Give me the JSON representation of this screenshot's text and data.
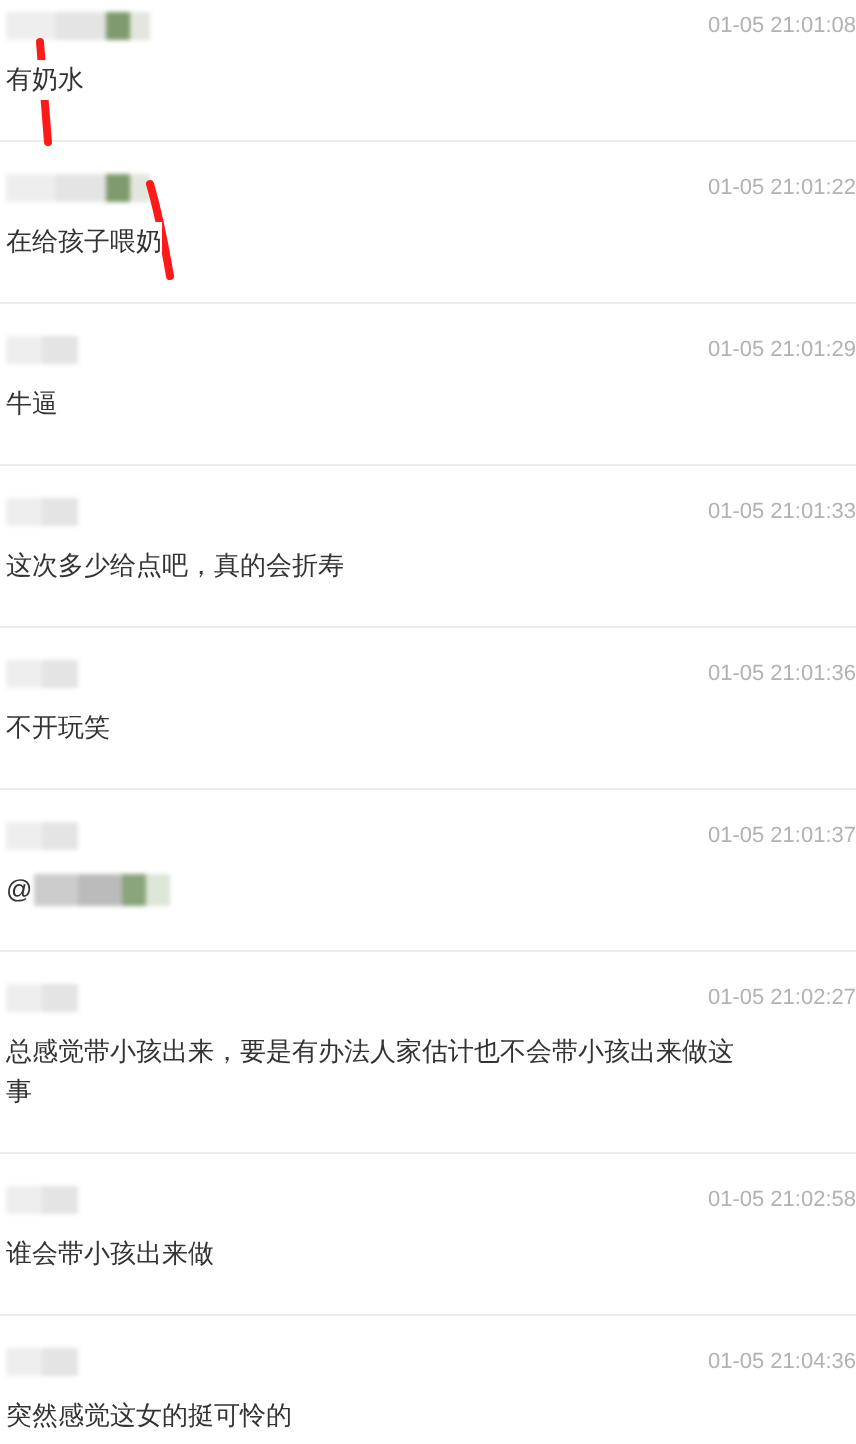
{
  "comments": [
    {
      "kind": "text",
      "time": "01-05 21:01:08",
      "text": "有奶水",
      "scribbled": true
    },
    {
      "kind": "text",
      "time": "01-05 21:01:22",
      "text": "在给孩子喂奶",
      "scribbled": true
    },
    {
      "kind": "text",
      "time": "01-05 21:01:29",
      "text": "牛逼",
      "scribbled": false
    },
    {
      "kind": "text",
      "time": "01-05 21:01:33",
      "text": "这次多少给点吧，真的会折寿",
      "scribbled": false
    },
    {
      "kind": "text",
      "time": "01-05 21:01:36",
      "text": "不开玩笑",
      "scribbled": false
    },
    {
      "kind": "mention",
      "time": "01-05 21:01:37",
      "text": "@",
      "scribbled": false
    },
    {
      "kind": "text",
      "time": "01-05 21:02:27",
      "text": "总感觉带小孩出来，要是有办法人家估计也不会带小孩出来做这事",
      "scribbled": false
    },
    {
      "kind": "text",
      "time": "01-05 21:02:58",
      "text": "谁会带小孩出来做",
      "scribbled": false
    },
    {
      "kind": "text",
      "time": "01-05 21:04:36",
      "text": "突然感觉这女的挺可怜的",
      "scribbled": false
    }
  ]
}
